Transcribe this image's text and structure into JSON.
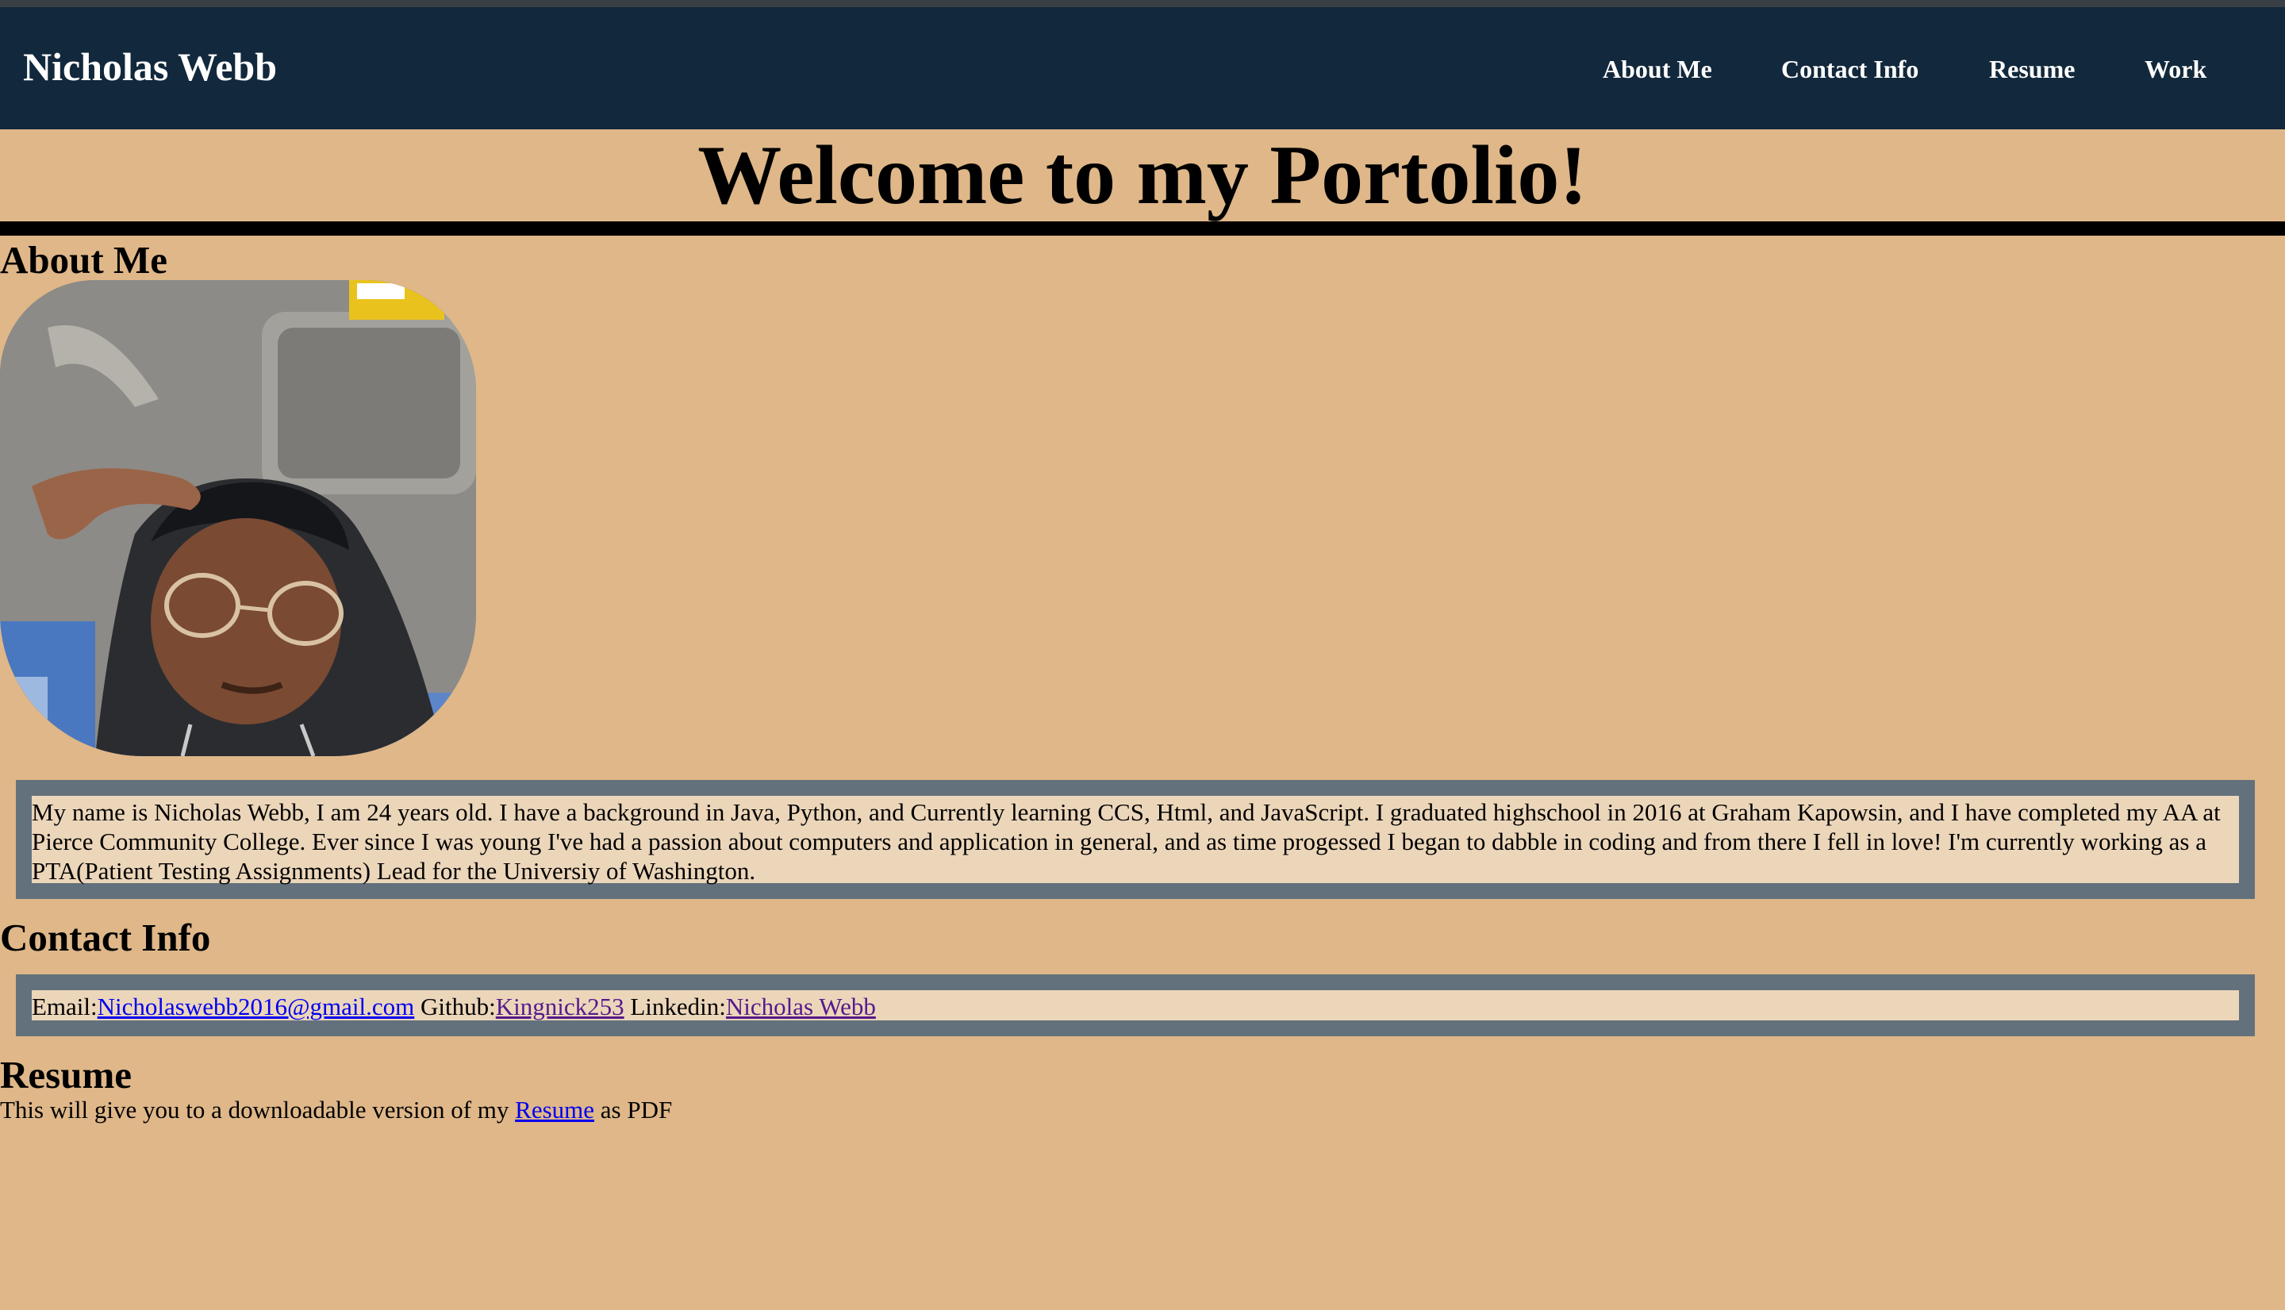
{
  "nav": {
    "brand": "Nicholas Webb",
    "links": [
      "About Me",
      "Contact Info",
      "Resume",
      "Work"
    ]
  },
  "hero": {
    "title": "Welcome to my Portolio!"
  },
  "about": {
    "heading": "About Me",
    "photo_alt": "selfie-photo",
    "bio": "My name is Nicholas Webb, I am 24 years old. I have a background in Java, Python, and Currently learning CCS, Html, and JavaScript. I graduated highschool in 2016 at Graham Kapowsin, and I have completed my AA at Pierce Community College. Ever since I was young I've had a passion about computers and application in general, and as time progessed I began to dabble in coding and from there I fell in love! I'm currently working as a PTA(Patient Testing Assignments) Lead for the Universiy of Washington."
  },
  "contact": {
    "heading": "Contact Info",
    "email_label": "Email:",
    "email": "Nicholaswebb2016@gmail.com",
    "github_label": "Github:",
    "github": "Kingnick253",
    "linkedin_label": "Linkedin:",
    "linkedin": "Nicholas Webb"
  },
  "resume": {
    "heading": "Resume",
    "text_before": "This will give you to a downloadable version of my ",
    "link": "Resume",
    "text_after": " as PDF"
  },
  "colors": {
    "background": "#dfb789",
    "navbar": "#12283c",
    "box_border": "#63717c",
    "box_fill": "#ecd6ba"
  }
}
